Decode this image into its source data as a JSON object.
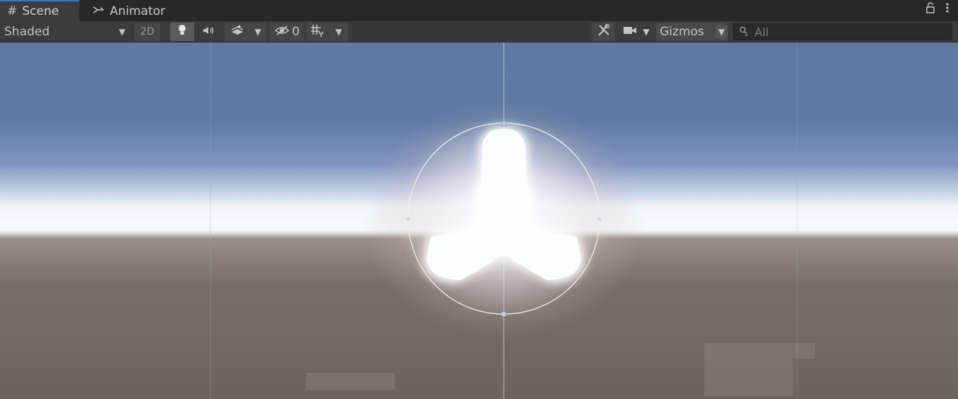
{
  "tabs": [
    {
      "label": "Scene",
      "icon": "grid-hash-icon",
      "active": true
    },
    {
      "label": "Animator",
      "icon": "animator-icon",
      "active": false
    }
  ],
  "window_controls": {
    "lock_icon": "lock-icon",
    "menu_icon": "kebab-menu-icon"
  },
  "toolbar": {
    "draw_mode": "Shaded",
    "mode_2d_label": "2D",
    "hidden_count": "0",
    "gizmos_label": "Gizmos",
    "search_placeholder": "All"
  },
  "colors": {
    "accent": "#3a79bb",
    "panel": "#3c3c3c",
    "sky_top": "#5b77a3",
    "horizon": "#f2f6fb",
    "ground": "#6d645e"
  }
}
